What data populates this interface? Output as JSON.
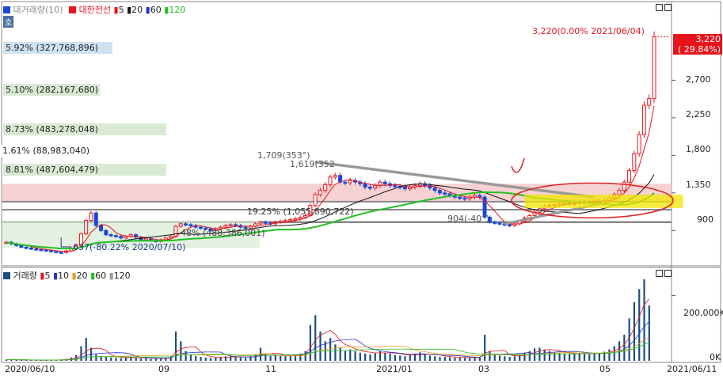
{
  "price_panel": {
    "legend": {
      "volume_label": "대거래량(10)",
      "stock_name": "대한전선",
      "ma_periods": [
        "5",
        "20",
        "60",
        "120"
      ],
      "ma_colors": [
        "#e8141c",
        "#111111",
        "#2434c8",
        "#22c022"
      ]
    },
    "corner_label": "호",
    "latest_label": "3,220(0.00% 2021/06/04)",
    "current_price": "3,220",
    "current_change": "( 29.84%)",
    "y_ticks": [
      "2,700",
      "2,250",
      "1,800",
      "1,350",
      "900"
    ],
    "annotations": {
      "high": "1,709(353°)",
      "high2": "1,619(352",
      "low": "637(-80.22% 2020/07/10)",
      "low2": "904(-40°)",
      "mid": "19.25% (1,055,890,722)",
      "mid2": "48% (488,386,001)"
    },
    "volume_profile": [
      {
        "label": "5.92% (327,768,896)",
        "color": "#cfe2f3"
      },
      {
        "label": "5.10% (282,167,680)",
        "color": "#d9ead3"
      },
      {
        "label": "8.73% (483,278,048)",
        "color": "#d9ead3"
      },
      {
        "label": "1.61% (88,983,040)",
        "color": "#ffffff"
      },
      {
        "label": "8.81% (487,604,479)",
        "color": "#d9ead3"
      }
    ]
  },
  "volume_panel": {
    "legend": {
      "title": "거래량",
      "ma_periods": [
        "5",
        "10",
        "20",
        "60",
        "120"
      ],
      "ma_colors": [
        "#e8141c",
        "#2434c8",
        "#e0a020",
        "#22c022",
        "#999999"
      ]
    },
    "y_ticks": [
      "200,000K",
      "0K"
    ]
  },
  "x_axis": {
    "labels": [
      "2020/06/10",
      "09",
      "11",
      "2021/01",
      "03",
      "05",
      "2021/06/11"
    ]
  },
  "colors": {
    "up": "#e8141c",
    "down": "#1a48d8",
    "volume": "#1d4e80",
    "resistance_band": "#f4c7c7",
    "triangle": "#999999",
    "highlight": "#f2e600",
    "circle": "#e02020"
  },
  "chart_data": [
    {
      "type": "candlestick",
      "title": "대한전선",
      "y_ticks": [
        900,
        1350,
        1800,
        2250,
        2700
      ],
      "ylim": [
        600,
        3450
      ],
      "x_labels": [
        "2020/06/10",
        "09",
        "11",
        "2021/01",
        "03",
        "05",
        "2021/06/11"
      ],
      "series": [
        {
          "name": "price",
          "close": [
            760,
            740,
            720,
            700,
            690,
            680,
            672,
            668,
            660,
            650,
            640,
            637,
            655,
            690,
            720,
            860,
            1020,
            1110,
            960,
            900,
            850,
            840,
            830,
            810,
            830,
            850,
            820,
            790,
            800,
            780,
            770,
            790,
            810,
            830,
            950,
            980,
            970,
            960,
            940,
            930,
            920,
            900,
            920,
            940,
            960,
            970,
            960,
            940,
            930,
            950,
            980,
            1000,
            990,
            980,
            1000,
            1010,
            1020,
            1030,
            1040,
            1060,
            1080,
            1200,
            1330,
            1380,
            1450,
            1540,
            1560,
            1480,
            1470,
            1500,
            1480,
            1460,
            1420,
            1410,
            1440,
            1480,
            1460,
            1440,
            1430,
            1420,
            1400,
            1420,
            1440,
            1460,
            1440,
            1410,
            1380,
            1350,
            1340,
            1320,
            1300,
            1290,
            1280,
            1300,
            1320,
            1300,
            1060,
            1000,
            990,
            980,
            970,
            960,
            980,
            1010,
            1050,
            1080,
            1120,
            1160,
            1190,
            1200,
            1210,
            1220,
            1230,
            1220,
            1230,
            1240,
            1230,
            1240,
            1250,
            1230,
            1260,
            1290,
            1330,
            1380,
            1480,
            1620,
            1820,
            2050,
            2400,
            2480,
            3220
          ]
        },
        {
          "name": "5",
          "values": []
        },
        {
          "name": "20",
          "values": []
        },
        {
          "name": "60",
          "values": []
        },
        {
          "name": "120",
          "values": []
        }
      ]
    },
    {
      "type": "bar",
      "title": "거래량",
      "y_ticks": [
        "200,000K",
        "0K"
      ],
      "series": [
        {
          "name": "volume",
          "values": [
            4,
            3,
            3,
            2,
            2,
            2,
            2,
            2,
            2,
            3,
            3,
            4,
            6,
            10,
            18,
            45,
            70,
            40,
            20,
            15,
            12,
            10,
            9,
            8,
            10,
            12,
            9,
            7,
            8,
            6,
            6,
            8,
            10,
            14,
            90,
            60,
            30,
            20,
            15,
            12,
            10,
            9,
            10,
            12,
            14,
            15,
            12,
            10,
            9,
            14,
            20,
            40,
            22,
            15,
            18,
            15,
            14,
            16,
            18,
            22,
            30,
            110,
            140,
            90,
            60,
            70,
            50,
            40,
            30,
            35,
            30,
            25,
            22,
            20,
            24,
            30,
            25,
            22,
            18,
            16,
            14,
            18,
            22,
            26,
            20,
            16,
            14,
            12,
            12,
            11,
            10,
            10,
            9,
            10,
            11,
            10,
            80,
            30,
            20,
            16,
            14,
            12,
            14,
            18,
            25,
            30,
            38,
            40,
            34,
            30,
            26,
            24,
            22,
            20,
            22,
            24,
            22,
            20,
            24,
            22,
            28,
            35,
            45,
            60,
            80,
            130,
            180,
            220,
            250,
            170
          ]
        },
        {
          "name": "5",
          "values": []
        },
        {
          "name": "10",
          "values": []
        },
        {
          "name": "20",
          "values": []
        },
        {
          "name": "60",
          "values": []
        },
        {
          "name": "120",
          "values": []
        }
      ]
    }
  ]
}
